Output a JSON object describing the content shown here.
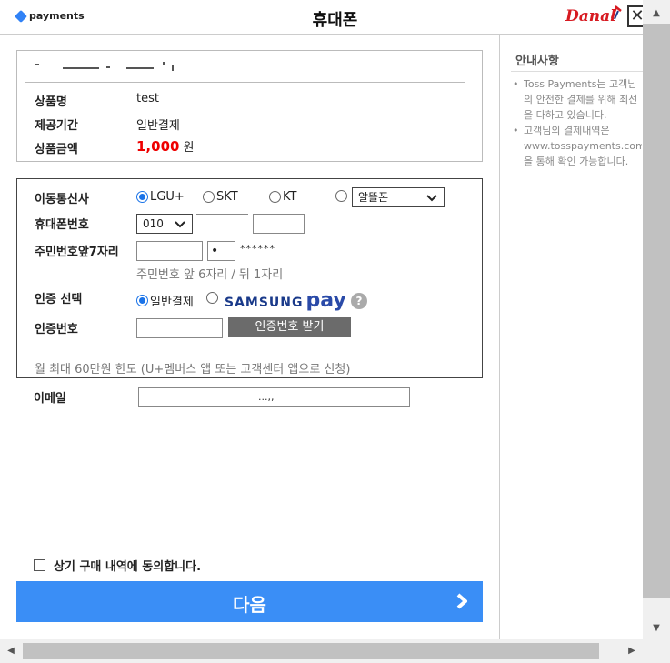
{
  "header": {
    "brand": "payments",
    "title": "휴대폰",
    "partner": "Danal",
    "close_label": "✕"
  },
  "product": {
    "rows": [
      {
        "label": "상품명",
        "value": "test"
      },
      {
        "label": "제공기간",
        "value": "일반결제"
      }
    ],
    "price_label": "상품금액",
    "price_value": "1,000",
    "price_unit": "원"
  },
  "form": {
    "carrier_label": "이동통신사",
    "carriers": [
      {
        "label": "LGU+",
        "selected": true
      },
      {
        "label": "SKT",
        "selected": false
      },
      {
        "label": "KT",
        "selected": false
      }
    ],
    "mvno_select": "알뜰폰",
    "phone_label": "휴대폰번호",
    "phone_prefix": "010",
    "ssn_label": "주민번호앞7자리",
    "ssn_mask": "******",
    "ssn_hint": "주민번호 앞 6자리 / 뒤 1자리",
    "auth_method_label": "인증 선택",
    "auth_methods": [
      {
        "label": "일반결제",
        "selected": true
      }
    ],
    "samsung_text": "SAMSUNG",
    "samsung_pay": "pay",
    "help_icon": "?",
    "auth_code_label": "인증번호",
    "auth_code_button": "인증번호 받기",
    "limit_note": "월 최대 60만원 한도 (U+멤버스 앱 또는 고객센터 앱으로 신청)"
  },
  "email": {
    "label": "이메일",
    "value": "...,,"
  },
  "agree_label": "상기 구매 내역에 동의합니다.",
  "next_button": "다음",
  "notice": {
    "title": "안내사항",
    "items": [
      "Toss Payments는 고객님의 안전한 결제를 위해 최선을 다하고 있습니다.",
      "고객님의 결제내역은 www.tosspayments.com을 통해 확인 가능합니다."
    ]
  },
  "colors": {
    "accent": "#3a8ef6",
    "price": "#ee0000",
    "danal": "#d71a21"
  }
}
